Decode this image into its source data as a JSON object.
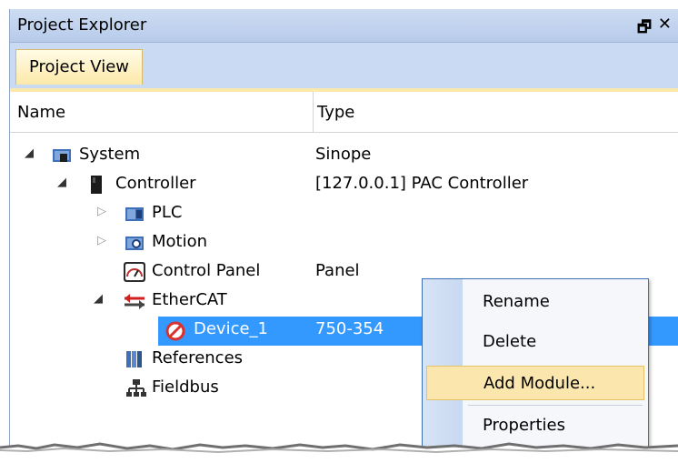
{
  "window": {
    "title": "Project Explorer",
    "pin_glyph": "⏏",
    "close_glyph": "✕"
  },
  "tabs": [
    {
      "label": "Project View",
      "active": true
    }
  ],
  "columns": {
    "name": "Name",
    "type": "Type"
  },
  "tree": [
    {
      "label": "System",
      "type": "Sinope",
      "level": 0,
      "toggle": "expanded",
      "icon": "system-icon"
    },
    {
      "label": "Controller",
      "type": "[127.0.0.1] PAC Controller",
      "level": 1,
      "toggle": "expanded",
      "icon": "controller-icon"
    },
    {
      "label": "PLC",
      "type": "",
      "level": 2,
      "toggle": "collapsed",
      "icon": "plc-icon"
    },
    {
      "label": "Motion",
      "type": "",
      "level": 2,
      "toggle": "collapsed",
      "icon": "motion-icon"
    },
    {
      "label": "Control Panel",
      "type": "Panel",
      "level": 2,
      "toggle": "none",
      "icon": "gauge-icon"
    },
    {
      "label": "EtherCAT",
      "type": "",
      "level": 2,
      "toggle": "expanded",
      "icon": "ethercat-icon"
    },
    {
      "label": "Device_1",
      "type": "750-354",
      "level": 3,
      "toggle": "none",
      "icon": "error-icon",
      "selected": true
    },
    {
      "label": "References",
      "type": "",
      "level": 2,
      "toggle": "none",
      "icon": "references-icon"
    },
    {
      "label": "Fieldbus",
      "type": "",
      "level": 2,
      "toggle": "none",
      "icon": "network-icon"
    }
  ],
  "context_menu": {
    "items": [
      {
        "label": "Rename"
      },
      {
        "label": "Delete"
      },
      {
        "label": "Add Module...",
        "highlighted": true
      },
      {
        "label": "Properties"
      }
    ]
  },
  "colors": {
    "accent": "#3399ff",
    "menu_highlight": "#fbe7ad",
    "tab_active": "#fde9a9"
  }
}
